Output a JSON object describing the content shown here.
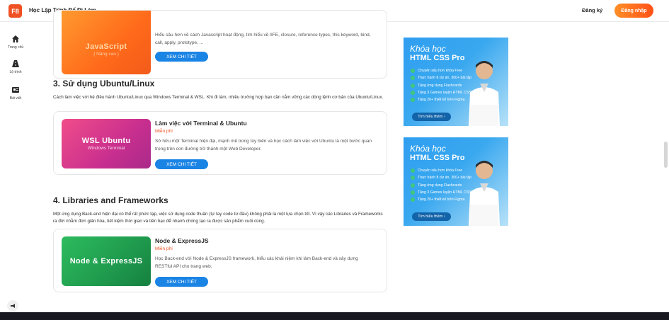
{
  "header": {
    "logo_text": "F8",
    "site_title": "Học Lập Trình Để Đi Làm",
    "register_label": "Đăng ký",
    "login_label": "Đăng nhập"
  },
  "sidebar": {
    "items": [
      {
        "label": "Trang chủ",
        "icon": "home-icon"
      },
      {
        "label": "Lộ trình",
        "icon": "road-icon"
      },
      {
        "label": "Bài viết",
        "icon": "news-icon"
      }
    ]
  },
  "courses": {
    "js": {
      "thumb_title": "JavaScript",
      "thumb_sub": "{ Nâng cao }",
      "desc": "Hiểu sâu hơn về cách Javascript hoạt động, tìm hiểu về IIFE, closure, reference types, this keyword, bind, call, apply, prototype, ...",
      "button": "XEM CHI TIẾT"
    },
    "ubuntu": {
      "section_title": "3. Sử dụng Ubuntu/Linux",
      "section_desc": "Cách làm việc với hệ điều hành Ubuntu/Linux qua Windows Terminal & WSL. Khi đi làm, nhiều trường hợp bạn cần nắm vững các dòng lệnh cơ bản của Ubuntu/Linux.",
      "thumb_title": "WSL Ubuntu",
      "thumb_sub": "Windows Terminal",
      "title": "Làm việc với Terminal & Ubuntu",
      "price": "Miễn phí",
      "desc": "Sở hữu một Terminal hiện đại, mạnh mẽ trong tùy biến và học cách làm việc với Ubuntu là một bước quan trọng trên con đường trở thành một Web Developer.",
      "button": "XEM CHI TIẾT"
    },
    "node": {
      "section_title": "4. Libraries and Frameworks",
      "section_desc": "Một ứng dụng Back-end hiện đại có thể rất phức tạp, việc sử dụng code thuần (tự tay code từ đầu) không phải là một lựa chọn tốt. Vì vậy các Libraries và Frameworks ra đời nhằm đơn giản hóa, tiết kiệm thời gian và tiền bạc để nhanh chóng tạo ra được sản phẩm cuối cùng.",
      "thumb_title": "Node & ExpressJS",
      "title": "Node & ExpressJS",
      "price": "Miễn phí",
      "desc": "Học Back-end với Node & ExpressJS framework, hiểu các khái niệm khi làm Back-end và xây dựng RESTful API cho trang web.",
      "button": "XEM CHI TIẾT"
    }
  },
  "ad": {
    "kicker": "Khóa học",
    "headline": "HTML CSS Pro",
    "features": [
      "Chuyên sâu hơn khóa Free",
      "Thực hành 8 dự án, 300+ bài tập",
      "Tặng ứng dụng Flashcards",
      "Tặng 3 Games luyện HTML CSS",
      "Tặng 20+ thiết kế trên Figma"
    ],
    "button": "Tìm hiểu thêm ›"
  },
  "colors": {
    "brand": "#f05123",
    "button_blue": "#1a84e5",
    "footer": "#181821"
  }
}
